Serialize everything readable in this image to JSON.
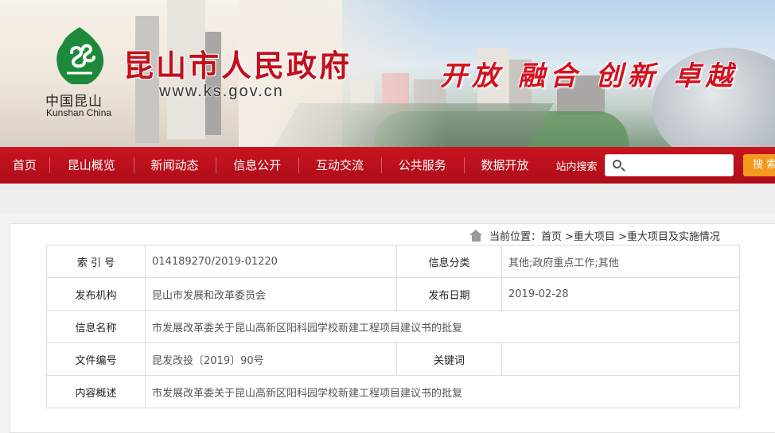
{
  "header": {
    "site_title": "昆山市人民政府",
    "site_url": "www.ks.gov.cn",
    "logo_cn": "中国昆山",
    "logo_en": "Kunshan China",
    "slogan": "开放 融合 创新 卓越",
    "brand_color": "#c2101d"
  },
  "nav": {
    "items": [
      "首页",
      "昆山概览",
      "新闻动态",
      "信息公开",
      "互动交流",
      "公共服务",
      "数据开放"
    ],
    "search_label": "站内搜索",
    "search_placeholder": "",
    "search_button": "搜 索",
    "search_icon": "search-icon"
  },
  "breadcrumb": {
    "prefix": "当前位置：",
    "items": [
      "首页",
      ">重大项目",
      ">重大项目及实施情况"
    ]
  },
  "info_table": {
    "index_label": "索 引 号",
    "index_value": "014189270/2019-01220",
    "category_label": "信息分类",
    "category_value": "其他;政府重点工作;其他",
    "publisher_label": "发布机构",
    "publisher_value": "昆山市发展和改革委员会",
    "date_label": "发布日期",
    "date_value": "2019-02-28",
    "name_label": "信息名称",
    "name_value": "市发展改革委关于昆山高新区阳科园学校新建工程项目建议书的批复",
    "doc_no_label": "文件编号",
    "doc_no_value": "昆发改投〔2019〕90号",
    "keywords_label": "关键词",
    "keywords_value": "",
    "summary_label": "内容概述",
    "summary_value": "市发展改革委关于昆山高新区阳科园学校新建工程项目建议书的批复"
  }
}
